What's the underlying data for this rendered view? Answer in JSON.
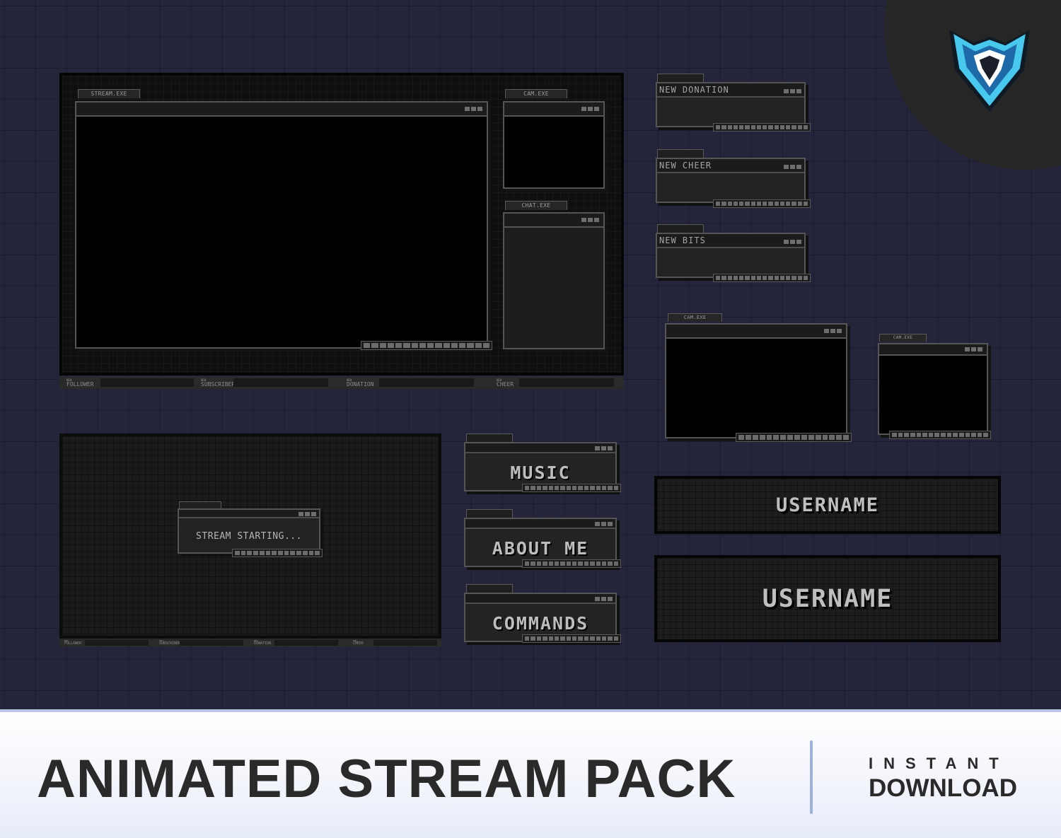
{
  "overlay": {
    "stream_tab": "STREAM.EXE",
    "cam_tab": "CAM.EXE",
    "chat_tab": "CHAT.EXE",
    "alerts": [
      {
        "new": "NEW",
        "label": "FOLLOWER"
      },
      {
        "new": "NEW",
        "label": "SUBSCRIBER"
      },
      {
        "new": "NEW",
        "label": "DONATION"
      },
      {
        "new": "NEW",
        "label": "CHEER"
      }
    ]
  },
  "alert_boxes": {
    "donation": "NEW DONATION",
    "cheer": "NEW CHEER",
    "bits": "NEW BITS"
  },
  "webcams": {
    "large_tab": "CAM.EXE",
    "small_tab": "CAM.EXE"
  },
  "starting_screen": {
    "label": "STREAM STARTING...",
    "alerts": [
      {
        "new": "NEW",
        "label": "FOLLOWER"
      },
      {
        "new": "NEW",
        "label": "SUBSCRIBER"
      },
      {
        "new": "NEW",
        "label": "DONATION"
      },
      {
        "new": "NEW",
        "label": "CHEER"
      }
    ]
  },
  "panels": {
    "music": "MUSIC",
    "about": "ABOUT ME",
    "commands": "COMMANDS"
  },
  "username_boxes": {
    "first": "USERNAME",
    "second": "USERNAME"
  },
  "banner": {
    "title": "ANIMATED STREAM PACK",
    "instant": "INSTANT",
    "download": "DOWNLOAD"
  },
  "colors": {
    "background": "#24243b",
    "logo_primary": "#5ad2f0",
    "logo_dark": "#1b1f2a",
    "banner_text": "#2a2a2a"
  },
  "icons": [
    "shield-v-logo-icon",
    "window-dots-icon"
  ]
}
